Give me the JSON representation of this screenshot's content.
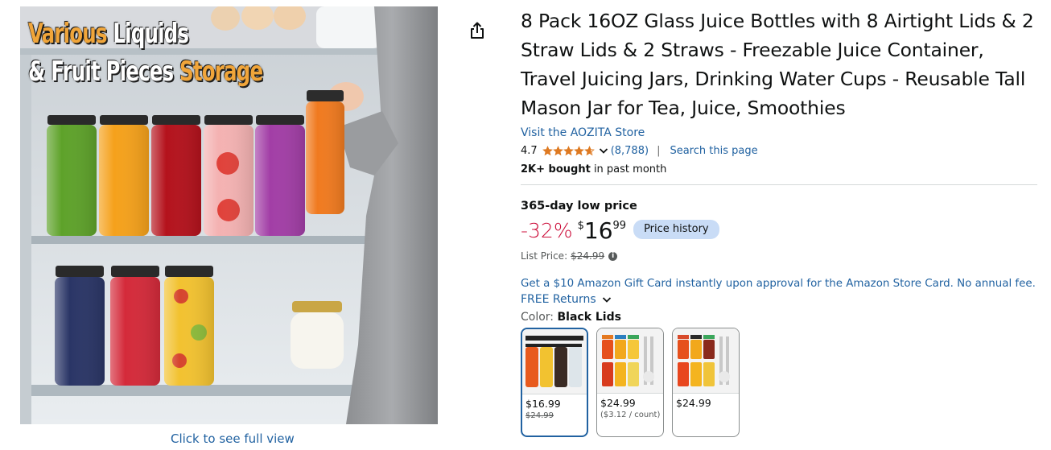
{
  "hero": {
    "caption_line1_part1": "Various",
    "caption_line1_part2": "Liquids",
    "caption_line2_part1": "& Fruit Pieces",
    "caption_line2_part2": "Storage",
    "full_view_link": "Click to see full view"
  },
  "product": {
    "title": "8 Pack 16OZ Glass Juice Bottles with 8 Airtight Lids & 2 Straw Lids & 2 Straws - Freezable Juice Container, Travel Juicing Jars, Drinking Water Cups - Reusable Tall Mason Jar for Tea, Juice, Smoothies",
    "store_link": "Visit the AOZITA Store",
    "rating": "4.7",
    "rating_fraction": 0.94,
    "rating_count": "(8,788)",
    "rating_separator": "|",
    "search_page": "Search this page",
    "bought_bold": "2K+ bought",
    "bought_rest": " in past month"
  },
  "pricing": {
    "deal_label": "365-day low price",
    "discount": "-32%",
    "currency": "$",
    "price_whole": "16",
    "price_fraction": "99",
    "price_history_button": "Price history",
    "list_price_label": "List Price:",
    "list_price_value": "$24.99",
    "info_icon": "i"
  },
  "offers": {
    "giftcard": "Get a $10 Amazon Gift Card instantly upon approval for the Amazon Store Card. No annual fee.",
    "returns": "FREE Returns"
  },
  "variants": {
    "color_label": "Color:",
    "color_value": "Black Lids",
    "swatches": [
      {
        "price": "$16.99",
        "old_price": "$24.99",
        "unit": ""
      },
      {
        "price": "$24.99",
        "old_price": "",
        "unit": "($3.12 / count)"
      },
      {
        "price": "$24.99",
        "old_price": "",
        "unit": ""
      }
    ]
  },
  "colors": {
    "link": "#2162a1",
    "discount": "#cc0c39",
    "star": "#de7921",
    "badge": "#c9dcf6"
  },
  "icons": [
    "share-icon",
    "star-icon",
    "chevron-down-icon",
    "info-icon"
  ]
}
